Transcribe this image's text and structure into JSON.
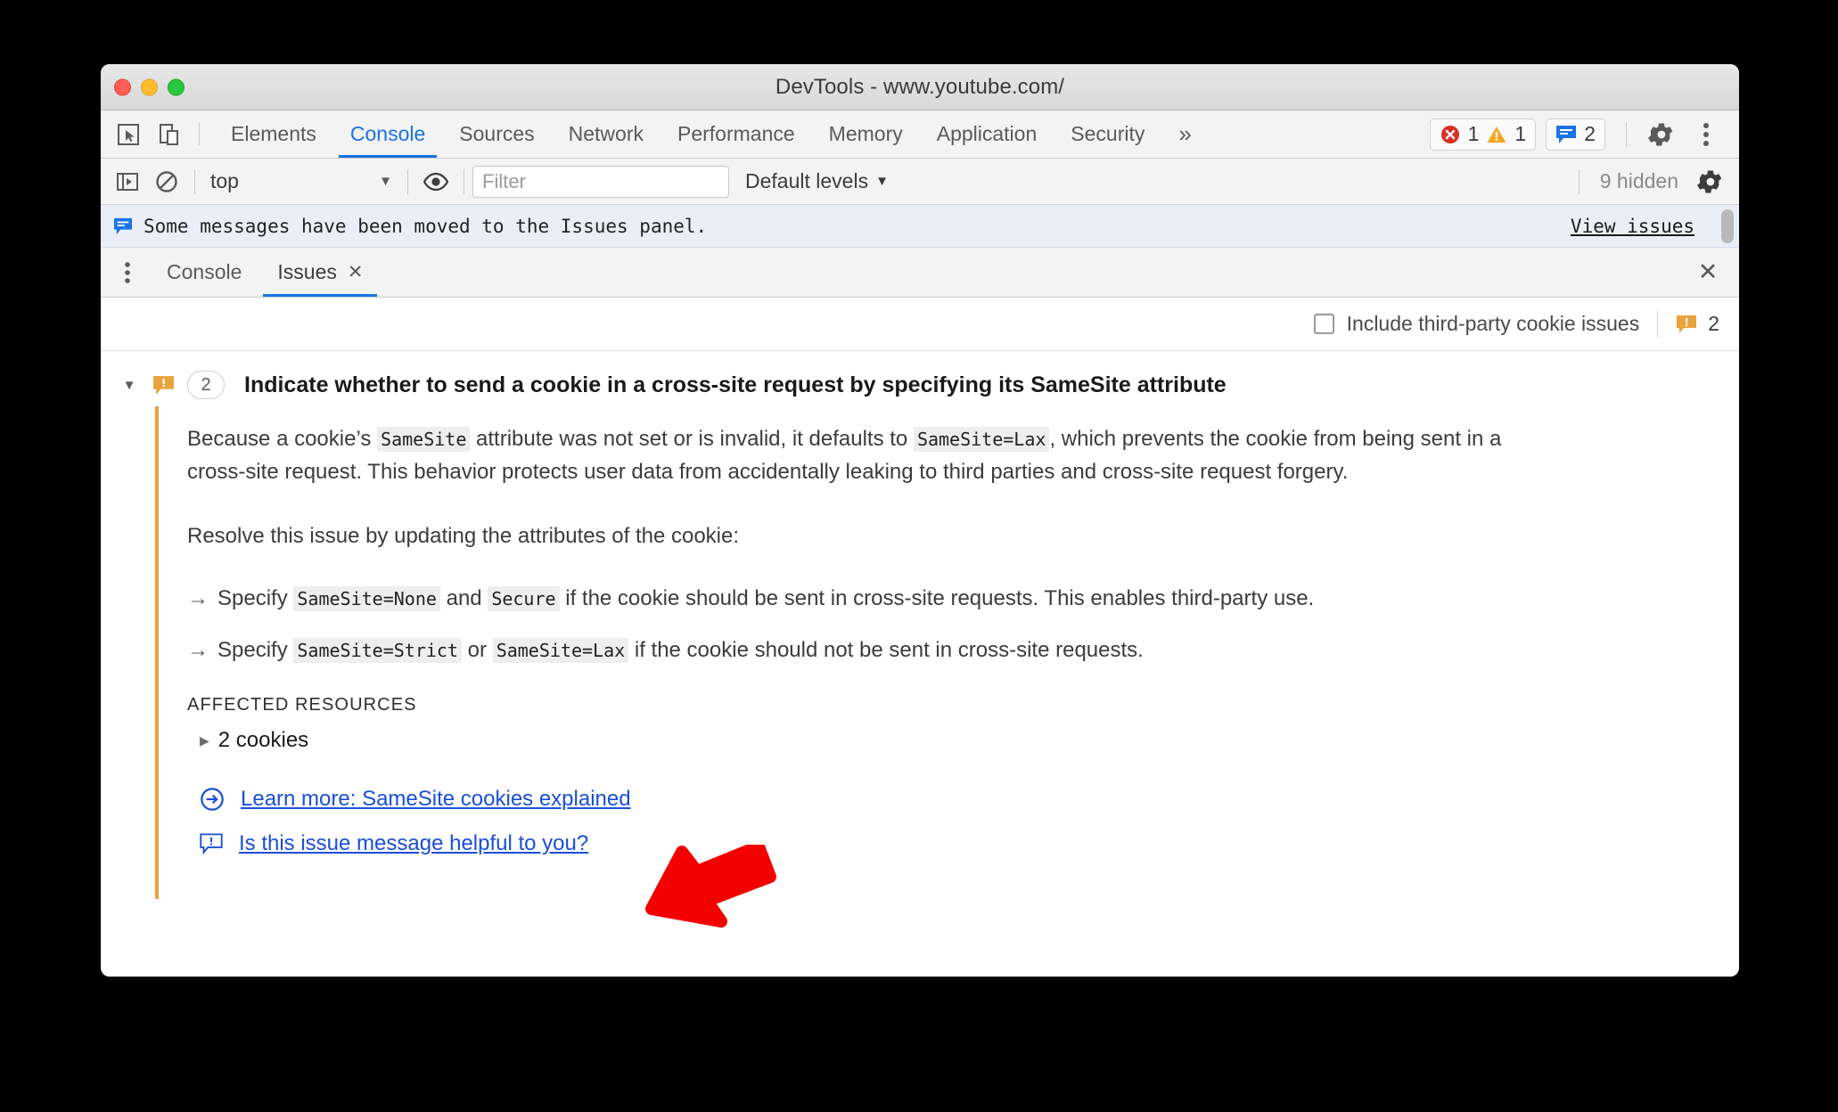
{
  "window": {
    "title": "DevTools - www.youtube.com/",
    "traffic_lights": [
      "close",
      "minimize",
      "zoom"
    ]
  },
  "main_tabbar": {
    "left_icons": [
      "inspect-element-icon",
      "device-toolbar-icon"
    ],
    "tabs": [
      {
        "label": "Elements",
        "active": false
      },
      {
        "label": "Console",
        "active": true
      },
      {
        "label": "Sources",
        "active": false
      },
      {
        "label": "Network",
        "active": false
      },
      {
        "label": "Performance",
        "active": false
      },
      {
        "label": "Memory",
        "active": false
      },
      {
        "label": "Application",
        "active": false
      },
      {
        "label": "Security",
        "active": false
      }
    ],
    "more_tabs_label": "»",
    "error_count": "1",
    "warning_count": "1",
    "issues_count": "2",
    "settings_icon": "gear-icon",
    "more_icon": "kebab-menu-icon"
  },
  "console_toolbar": {
    "sidebar_toggle_icon": "console-sidebar-icon",
    "clear_icon": "clear-console-icon",
    "context_value": "top",
    "context_caret": "▼",
    "eye_icon": "live-expression-icon",
    "filter_placeholder": "Filter",
    "filter_value": "",
    "levels_label": "Default levels",
    "levels_caret": "▼",
    "hidden_label": "9 hidden",
    "settings_icon": "console-settings-gear-icon"
  },
  "info_strip": {
    "icon": "issues-message-icon",
    "message": "Some messages have been moved to the Issues panel.",
    "action_label": "View issues"
  },
  "drawer": {
    "menu_icon": "drawer-kebab-icon",
    "tabs": [
      {
        "label": "Console",
        "active": false,
        "closable": false
      },
      {
        "label": "Issues",
        "active": true,
        "closable": true
      }
    ],
    "close_label": "✕",
    "close_icon": "close-drawer-icon"
  },
  "issues_filter": {
    "checkbox_label": "Include third-party cookie issues",
    "checkbox_checked": false,
    "badge_icon": "issue-warning-bubble-icon",
    "badge_count": "2"
  },
  "issue": {
    "twisty": "▼",
    "severity_icon": "issue-warning-bubble-icon",
    "count": "2",
    "title": "Indicate whether to send a cookie in a cross-site request by specifying its SameSite attribute",
    "paragraph1_a": "Because a cookie’s ",
    "paragraph1_code1": "SameSite",
    "paragraph1_b": " attribute was not set or is invalid, it defaults to ",
    "paragraph1_code2": "SameSite=Lax",
    "paragraph1_c": ", which prevents the cookie from being sent in a cross-site request. This behavior protects user data from accidentally leaking to third parties and cross-site request forgery.",
    "paragraph2": "Resolve this issue by updating the attributes of the cookie:",
    "bullets": [
      {
        "arrow": "→",
        "a": "Specify ",
        "code1": "SameSite=None",
        "b": " and ",
        "code2": "Secure",
        "c": " if the cookie should be sent in cross-site requests. This enables third-party use."
      },
      {
        "arrow": "→",
        "a": "Specify ",
        "code1": "SameSite=Strict",
        "b": " or ",
        "code2": "SameSite=Lax",
        "c": " if the cookie should not be sent in cross-site requests."
      }
    ],
    "affected_resources_heading": "AFFECTED RESOURCES",
    "affected_resource_twisty": "▶",
    "affected_resource_label": "2 cookies",
    "links": [
      {
        "icon": "external-link-arrow-icon",
        "label": "Learn more: SameSite cookies explained"
      },
      {
        "icon": "feedback-bubble-icon",
        "label": "Is this issue message helpful to you?"
      }
    ]
  },
  "annotation": {
    "arrow": "red-pointer-arrow",
    "color": "#f40000"
  },
  "colors": {
    "accent_blue": "#1a73e8",
    "link_blue": "#1a4fd8",
    "issue_orange": "#e8a33d",
    "error_red": "#d93025",
    "warning_yellow": "#f5a623",
    "info_bg": "#e9eef7"
  }
}
